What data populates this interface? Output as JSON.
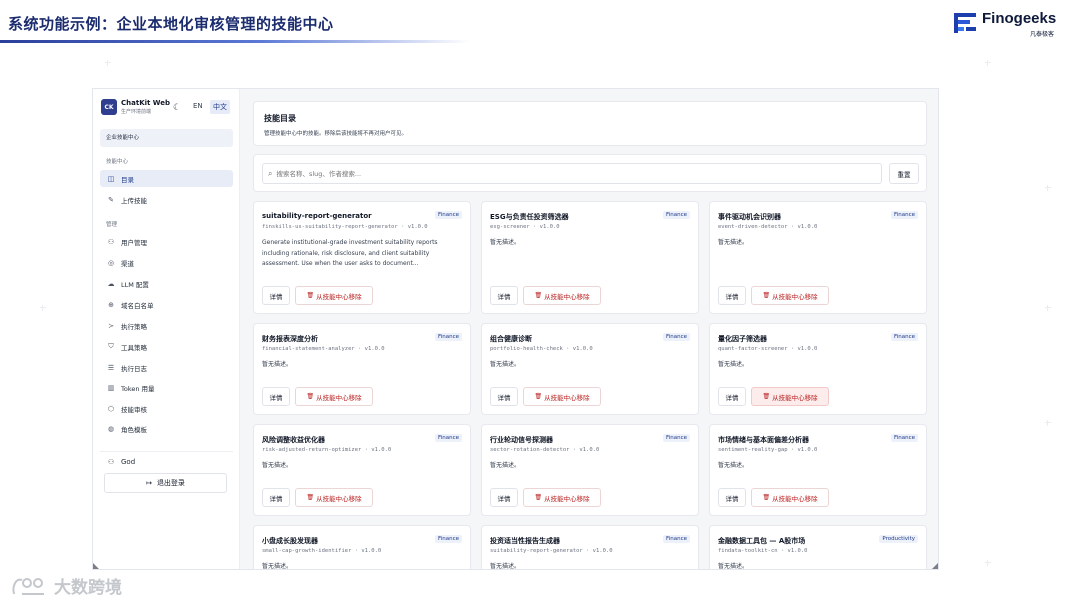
{
  "slide": {
    "title": "系统功能示例：企业本地化审核管理的技能中心",
    "logo_text": "Finogeeks",
    "logo_sub": "凡泰极客",
    "watermark": "大数跨境"
  },
  "app": {
    "brand_badge": "CK",
    "brand_name": "ChatKit Web",
    "brand_sub": "生产环境前端",
    "theme_icon": "moon-icon",
    "lang_en": "EN",
    "lang_zh": "中文",
    "center_label": "企业技能中心",
    "sections": [
      {
        "label": "技能中心"
      },
      {
        "label": "管理"
      }
    ],
    "nav": [
      {
        "label": "目录",
        "icon": "◫"
      },
      {
        "label": "上传技能",
        "icon": "✎"
      },
      {
        "label": "用户管理",
        "icon": "⚇"
      },
      {
        "label": "渠道",
        "icon": "◎"
      },
      {
        "label": "LLM 配置",
        "icon": "☁"
      },
      {
        "label": "域名白名单",
        "icon": "⊕"
      },
      {
        "label": "执行策略",
        "icon": "≻"
      },
      {
        "label": "工具策略",
        "icon": "⛉"
      },
      {
        "label": "执行日志",
        "icon": "☰"
      },
      {
        "label": "Token 用量",
        "icon": "▥"
      },
      {
        "label": "技能审核",
        "icon": "⬡"
      },
      {
        "label": "角色模板",
        "icon": "◍"
      }
    ],
    "user_name": "God",
    "logout_label": "退出登录"
  },
  "catalog": {
    "title": "技能目录",
    "description": "管理技能中心中的技能。移除后该技能将不再对用户可见。",
    "search_placeholder": "搜索名称、slug、作者搜索...",
    "reset_label": "重置",
    "detail_label": "详情",
    "remove_label": "从技能中心移除",
    "cards": [
      {
        "name": "suitability-report-generator",
        "slug": "finskills-us-suitability-report-generator · v1.0.0",
        "tag": "Finance",
        "desc": "Generate institutional-grade investment suitability reports including rationale, risk disclosure, and client suitability assessment. Use when the user asks to document..."
      },
      {
        "name": "ESG与负责任投资筛选器",
        "slug": "esg-screener · v1.0.0",
        "tag": "Finance",
        "desc": "暂无描述。"
      },
      {
        "name": "事件驱动机会识别器",
        "slug": "event-driven-detector · v1.0.0",
        "tag": "Finance",
        "desc": "暂无描述。"
      },
      {
        "name": "财务报表深度分析",
        "slug": "financial-statement-analyzer · v1.0.0",
        "tag": "Finance",
        "desc": "暂无描述。"
      },
      {
        "name": "组合健康诊断",
        "slug": "portfolio-health-check · v1.0.0",
        "tag": "Finance",
        "desc": "暂无描述。"
      },
      {
        "name": "量化因子筛选器",
        "slug": "quant-factor-screener · v1.0.0",
        "tag": "Finance",
        "desc": "暂无描述。"
      },
      {
        "name": "风险调整收益优化器",
        "slug": "risk-adjusted-return-optimizer · v1.0.0",
        "tag": "Finance",
        "desc": "暂无描述。"
      },
      {
        "name": "行业轮动信号探测器",
        "slug": "sector-rotation-detector · v1.0.0",
        "tag": "Finance",
        "desc": "暂无描述。"
      },
      {
        "name": "市场情绪与基本面偏差分析器",
        "slug": "sentiment-reality-gap · v1.0.0",
        "tag": "Finance",
        "desc": "暂无描述。"
      },
      {
        "name": "小盘成长股发现器",
        "slug": "small-cap-growth-identifier · v1.0.0",
        "tag": "Finance",
        "desc": "暂无描述。"
      },
      {
        "name": "投资适当性报告生成器",
        "slug": "suitability-report-generator · v1.0.0",
        "tag": "Finance",
        "desc": "暂无描述。"
      },
      {
        "name": "金融数据工具包 — A股市场",
        "slug": "findata-toolkit-cn · v1.0.0",
        "tag": "Productivity",
        "desc": "暂无描述。"
      }
    ]
  }
}
